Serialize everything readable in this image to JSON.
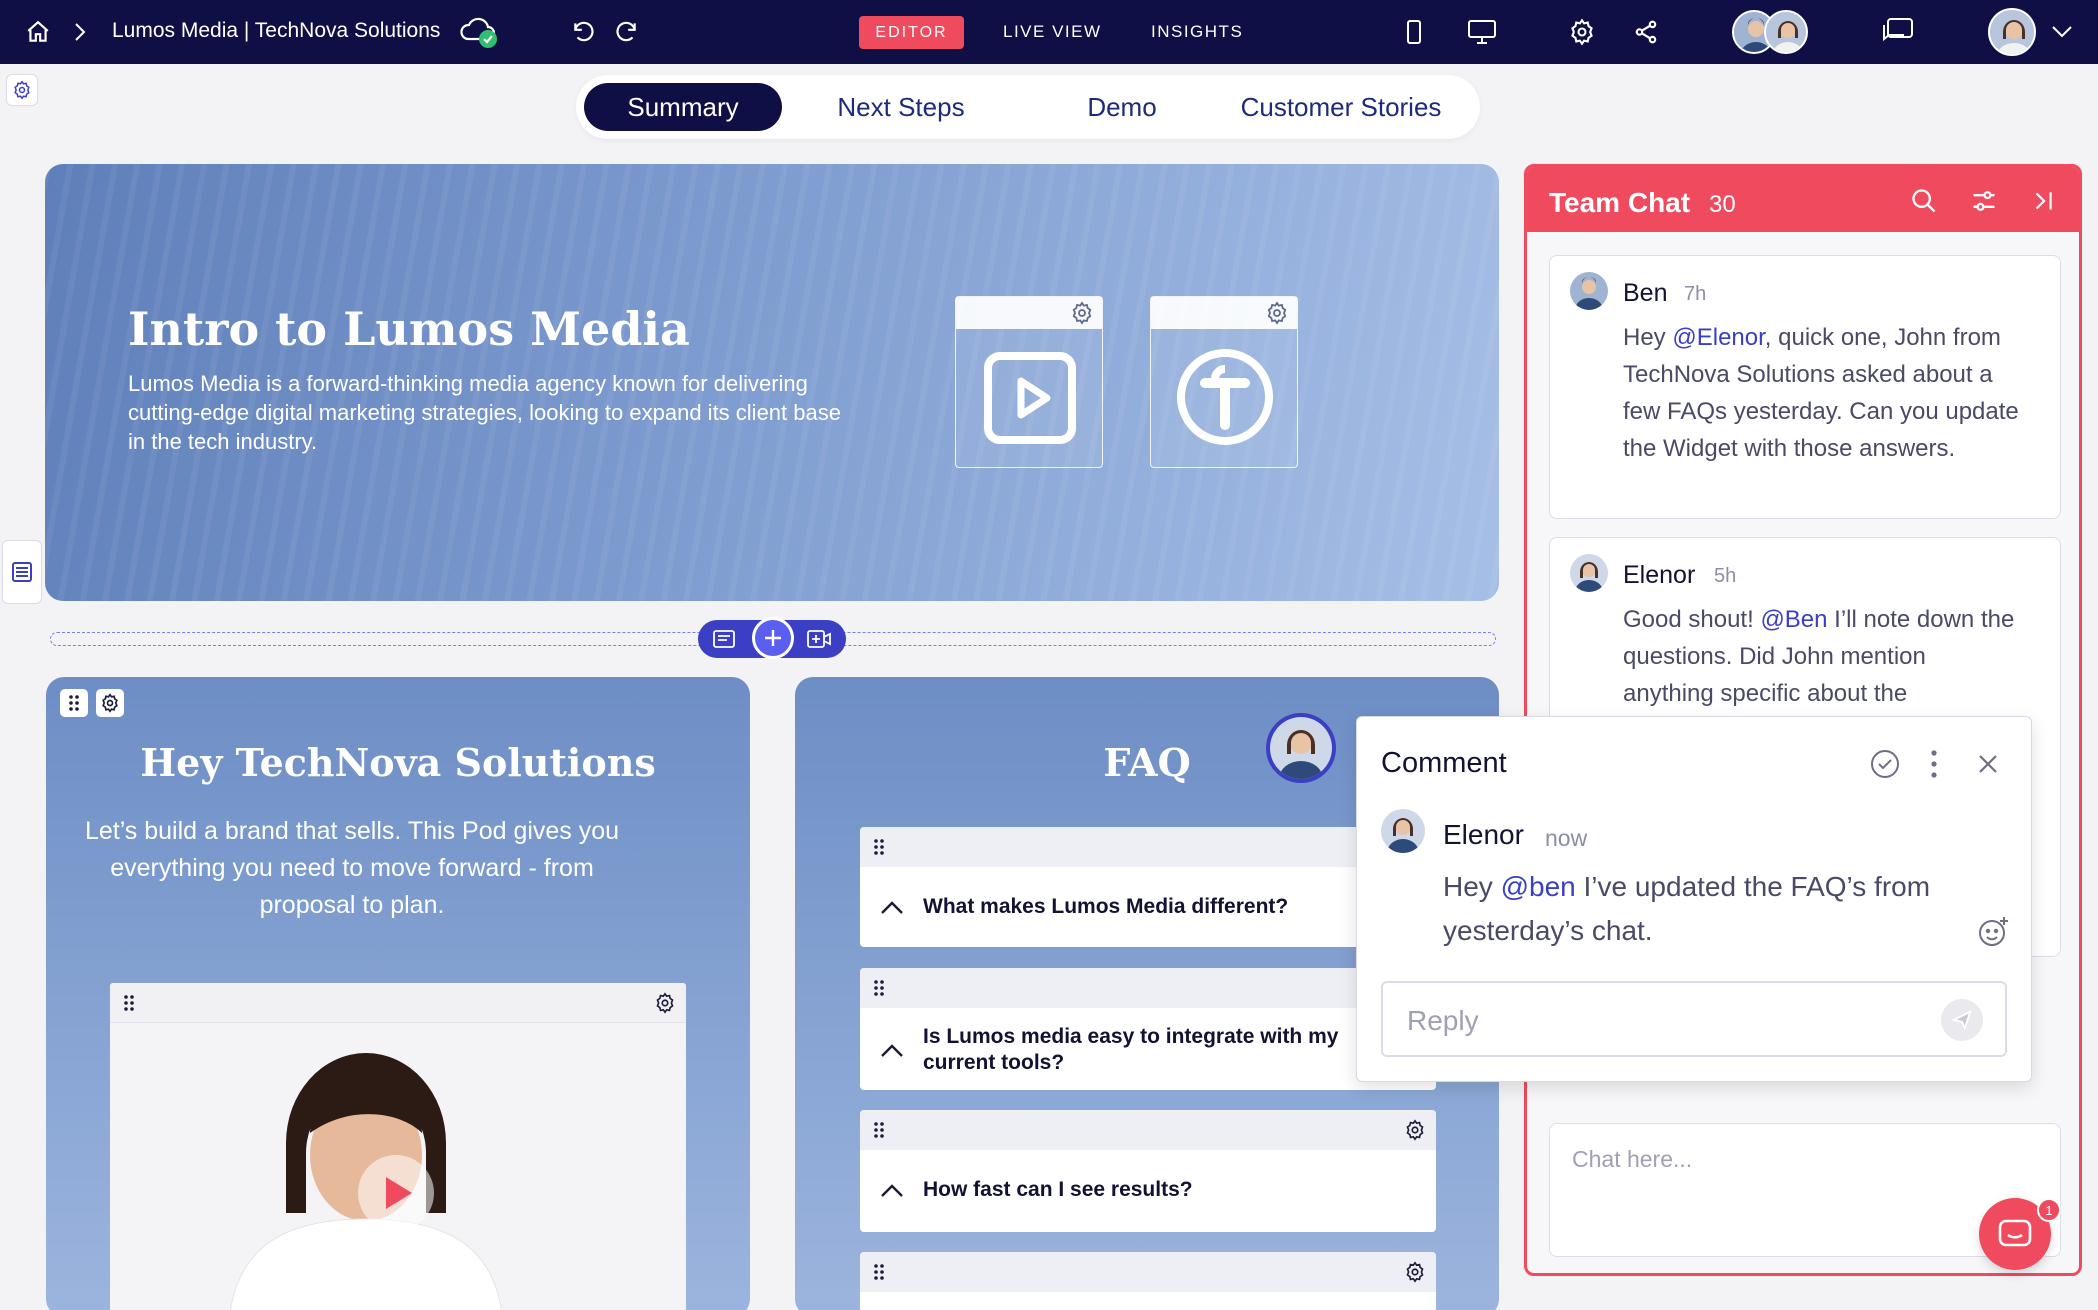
{
  "topbar": {
    "breadcrumb": "Lumos Media | TechNova Solutions",
    "modes": {
      "editor": "EDITOR",
      "live_view": "LIVE VIEW",
      "insights": "INSIGHTS"
    }
  },
  "tabs": [
    {
      "label": "Summary",
      "active": true
    },
    {
      "label": "Next Steps",
      "active": false
    },
    {
      "label": "Demo",
      "active": false
    },
    {
      "label": "Customer Stories",
      "active": false
    }
  ],
  "hero": {
    "title": "Intro to Lumos Media",
    "description": "Lumos Media is a forward-thinking media agency known for delivering cutting-edge digital marketing strategies, looking to expand its client base in the tech industry."
  },
  "intro_card": {
    "title": "Hey TechNova Solutions",
    "text": "Let’s build a brand that sells. This Pod gives you everything you need to move forward - from proposal to plan."
  },
  "faq": {
    "title": "FAQ",
    "items": [
      {
        "question": "What makes Lumos Media different?"
      },
      {
        "question": "Is Lumos media easy to integrate with my current tools?"
      },
      {
        "question": "How fast can I see results?"
      }
    ]
  },
  "team_chat": {
    "title": "Team Chat",
    "count": "30",
    "messages": [
      {
        "author": "Ben",
        "time": "7h",
        "pre": "Hey ",
        "mention": "@Elenor",
        "post": ", quick one, John from TechNova Solutions asked about a few FAQs yesterday. Can you update the Widget with those answers."
      },
      {
        "author": "Elenor",
        "time": "5h",
        "pre": "Good shout! ",
        "mention": "@Ben",
        "post": " I’ll note down the questions. Did John mention anything specific about the"
      }
    ],
    "input_placeholder": "Chat here...",
    "notification_count": "1"
  },
  "comment": {
    "title": "Comment",
    "author": "Elenor",
    "time": "now",
    "pre": "Hey ",
    "mention": "@ben",
    "post": " I’ve updated the FAQ’s from yesterday’s chat.",
    "reply_placeholder": "Reply"
  },
  "colors": {
    "topbar": "#0f0f45",
    "accent": "#ef4a5e",
    "mention": "#3b3fc4",
    "card_blue": "#6d8ec5"
  }
}
